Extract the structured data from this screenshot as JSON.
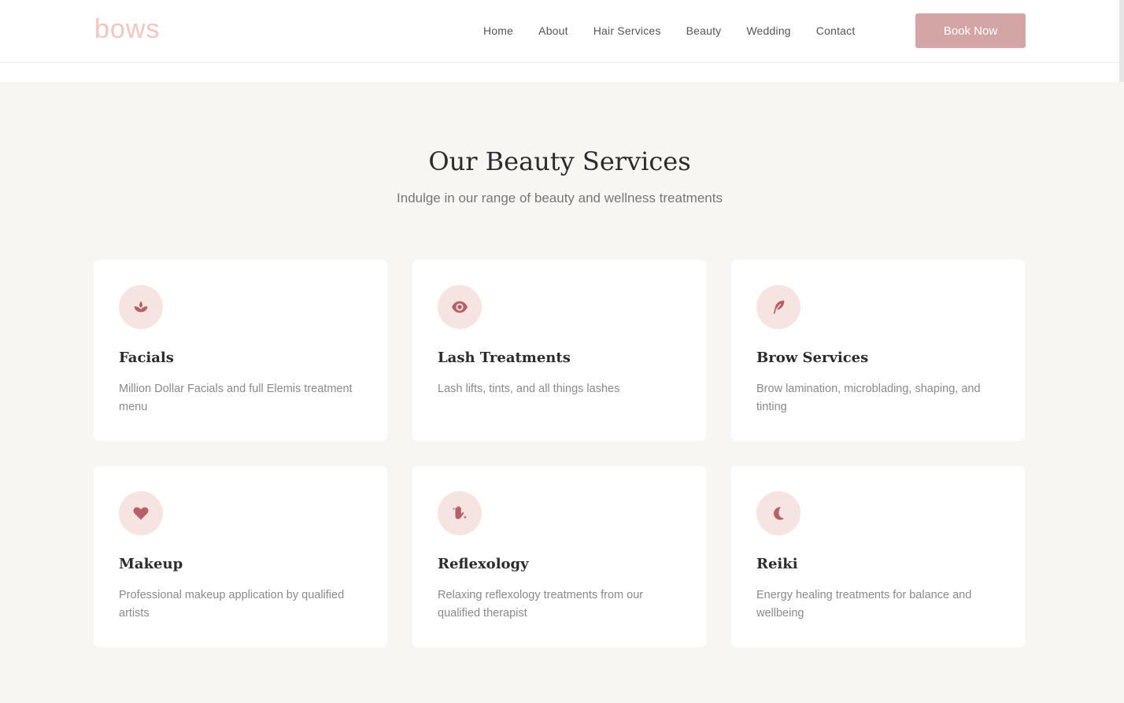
{
  "header": {
    "logo_text": "bows",
    "nav": [
      "Home",
      "About",
      "Hair Services",
      "Beauty",
      "Wedding",
      "Contact"
    ],
    "cta_label": "Book Now"
  },
  "section": {
    "title": "Our Beauty Services",
    "subtitle": "Indulge in our range of beauty and wellness treatments"
  },
  "services": [
    {
      "icon": "lotus-icon",
      "title": "Facials",
      "description": "Million Dollar Facials and full Elemis treatment menu"
    },
    {
      "icon": "eye-icon",
      "title": "Lash Treatments",
      "description": "Lash lifts, tints, and all things lashes"
    },
    {
      "icon": "feather-icon",
      "title": "Brow Services",
      "description": "Brow lamination, microblading, shaping, and tinting"
    },
    {
      "icon": "heart-icon",
      "title": "Makeup",
      "description": "Professional makeup application by qualified artists"
    },
    {
      "icon": "hand-sparkles-icon",
      "title": "Reflexology",
      "description": "Relaxing reflexology treatments from our qualified therapist"
    },
    {
      "icon": "moon-icon",
      "title": "Reiki",
      "description": "Energy healing treatments for balance and wellbeing"
    }
  ],
  "colors": {
    "accent": "#d4a5a5",
    "icon": "#b5606a",
    "icon_bg": "#f5e4e0",
    "logo": "#f1c6c0",
    "section_bg": "#f8f6f3"
  }
}
